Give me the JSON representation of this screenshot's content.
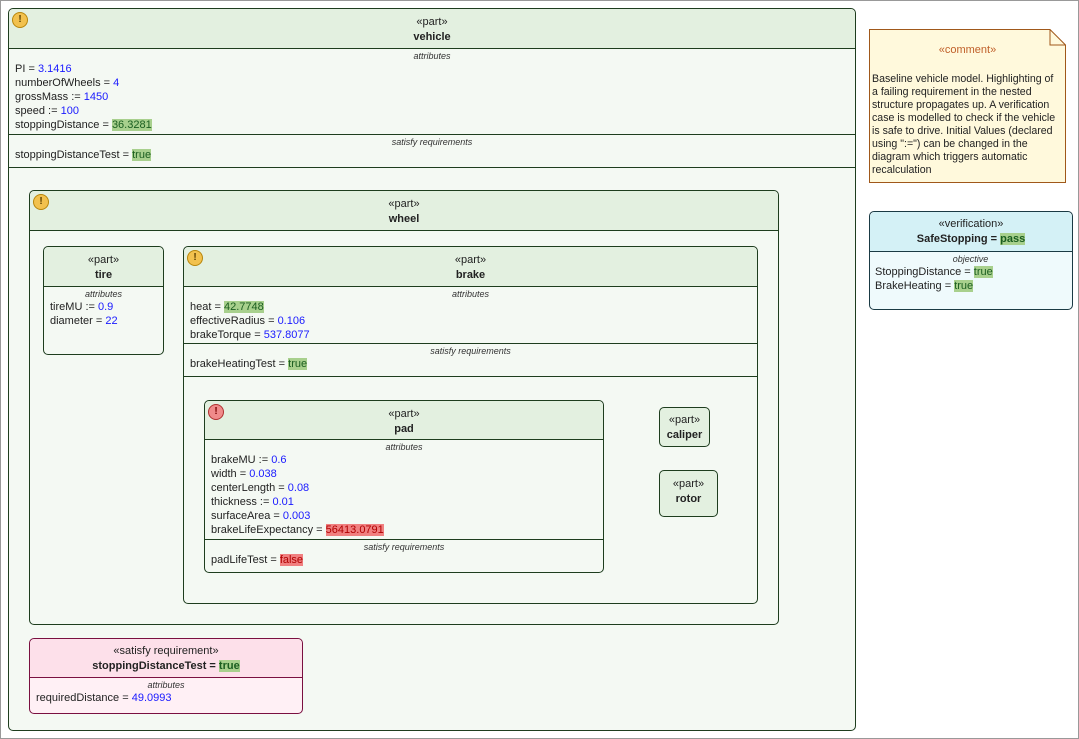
{
  "vehicle": {
    "stereotype": "«part»",
    "name": "vehicle",
    "attr_title": "attributes",
    "attrs": [
      {
        "n": "PI",
        "op": " = ",
        "v": "3.1416"
      },
      {
        "n": "numberOfWheels",
        "op": " = ",
        "v": "4"
      },
      {
        "n": "grossMass",
        "op": " := ",
        "v": "1450"
      },
      {
        "n": "speed",
        "op": " := ",
        "v": "100"
      },
      {
        "n": "stoppingDistance",
        "op": " = ",
        "v": "36.3281"
      }
    ],
    "req_title": "satisfy requirements",
    "reqs": [
      {
        "n": "stoppingDistanceTest",
        "op": " = ",
        "v": "true"
      }
    ]
  },
  "wheel": {
    "stereotype": "«part»",
    "name": "wheel"
  },
  "tire": {
    "stereotype": "«part»",
    "name": "tire",
    "attr_title": "attributes",
    "attrs": [
      {
        "n": "tireMU",
        "op": " := ",
        "v": "0.9"
      },
      {
        "n": "diameter",
        "op": " = ",
        "v": "22"
      }
    ]
  },
  "brake": {
    "stereotype": "«part»",
    "name": "brake",
    "attr_title": "attributes",
    "attrs": [
      {
        "n": "heat",
        "op": " = ",
        "v": "42.7748"
      },
      {
        "n": "effectiveRadius",
        "op": " = ",
        "v": "0.106"
      },
      {
        "n": "brakeTorque",
        "op": " = ",
        "v": "537.8077"
      }
    ],
    "req_title": "satisfy requirements",
    "reqs": [
      {
        "n": "brakeHeatingTest",
        "op": " = ",
        "v": "true"
      }
    ]
  },
  "pad": {
    "stereotype": "«part»",
    "name": "pad",
    "attr_title": "attributes",
    "attrs": [
      {
        "n": "brakeMU",
        "op": " := ",
        "v": "0.6"
      },
      {
        "n": "width",
        "op": " = ",
        "v": "0.038"
      },
      {
        "n": "centerLength",
        "op": " = ",
        "v": "0.08"
      },
      {
        "n": "thickness",
        "op": " := ",
        "v": "0.01"
      },
      {
        "n": "surfaceArea",
        "op": " = ",
        "v": "0.003"
      },
      {
        "n": "brakeLifeExpectancy",
        "op": " = ",
        "v": "56413.0791"
      }
    ],
    "req_title": "satisfy requirements",
    "reqs": [
      {
        "n": "padLifeTest",
        "op": " = ",
        "v": "false"
      }
    ]
  },
  "caliper": {
    "stereotype": "«part»",
    "name": "caliper"
  },
  "rotor": {
    "stereotype": "«part»",
    "name": "rotor"
  },
  "requirement": {
    "stereotype": "«satisfy requirement»",
    "name": "stoppingDistanceTest",
    "op": " = ",
    "value": "true",
    "attr_title": "attributes",
    "attrs": [
      {
        "n": "requiredDistance",
        "op": " = ",
        "v": "49.0993"
      }
    ]
  },
  "comment": {
    "stereotype": "«comment»",
    "text": "Baseline vehicle model. Highlighting of a failing requirement in the nested structure propagates up. A verification case is modelled to check if the vehicle is safe to drive. Initial Values (declared using \":=\") can be changed in the diagram which triggers automatic recalculation"
  },
  "verification": {
    "stereotype": "«verification»",
    "name": "SafeStopping",
    "op": " = ",
    "value": "pass",
    "obj_title": "objective",
    "objectives": [
      {
        "n": "StoppingDistance",
        "op": " = ",
        "v": "true"
      },
      {
        "n": "BrakeHeating",
        "op": " = ",
        "v": "true"
      }
    ]
  },
  "icons": {
    "warning": "!",
    "error": "!"
  }
}
